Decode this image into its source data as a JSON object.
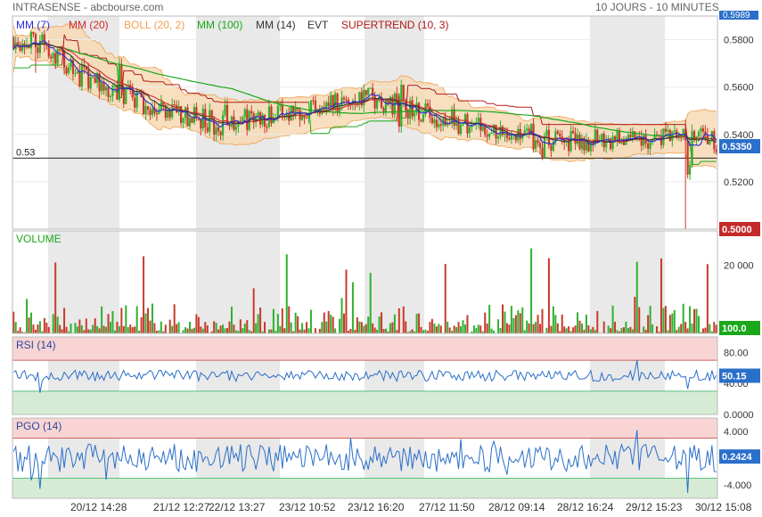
{
  "header": {
    "title": "INTRASENSE - abcbourse.com",
    "period": "10 JOURS - 10 MINUTES"
  },
  "legend": [
    {
      "label": "MM (7)",
      "color": "#2a2ad6"
    },
    {
      "label": "MM (20)",
      "color": "#d12a2a"
    },
    {
      "label": "BOLL (20, 2)",
      "color": "#f0a050"
    },
    {
      "label": "MM (100)",
      "color": "#1aa81a"
    },
    {
      "label": "MM (14)",
      "color": "#333333"
    },
    {
      "label": "EVT",
      "color": "#333333"
    },
    {
      "label": "SUPERTREND (10, 3)",
      "color": "#b01818"
    }
  ],
  "colors": {
    "up": "#2fb12f",
    "down": "#c93a2a",
    "boll_fill": "#f6d9b5",
    "boll_line": "#f0a050",
    "mm7": "#2a2ad6",
    "mm20": "#d12a2a",
    "mm100": "#1aa81a",
    "mm14": "#333333",
    "supertrend": "#b01818",
    "rsi_line": "#2a6fc9",
    "pgo_line": "#2a6fc9",
    "overbought": "#f8d4d4",
    "oversold": "#d6ebd3",
    "badge_current": "#2a6fc9",
    "badge_low": "#c42a2a",
    "badge_volume": "#1aa81a",
    "shade": "#e9e9e9"
  },
  "chart_data": [
    {
      "type": "candlestick",
      "name": "price",
      "yticks": [
        "0.5200",
        "0.5400",
        "0.5600",
        "0.5800"
      ],
      "ylim": [
        0.5,
        0.59
      ],
      "reference_line": {
        "value": 0.53,
        "label": "0.53"
      },
      "last_value": "0.5350",
      "min_label": "0.5000",
      "top_partial_label": "0.5989",
      "key_points": [
        {
          "x": "20/12 09:00",
          "y": 0.581
        },
        {
          "x": "20/12 14:28",
          "y": 0.553
        },
        {
          "x": "21/12 12:27",
          "y": 0.545
        },
        {
          "x": "22/12 13:27",
          "y": 0.553
        },
        {
          "x": "23/12 10:52",
          "y": 0.555
        },
        {
          "x": "23/12 16:20",
          "y": 0.542
        },
        {
          "x": "27/12 11:50",
          "y": 0.537
        },
        {
          "x": "28/12 09:14",
          "y": 0.537
        },
        {
          "x": "28/12 16:24",
          "y": 0.539
        },
        {
          "x": "29/12 15:23",
          "y": 0.54
        },
        {
          "x": "30/12 15:08",
          "y": 0.535
        }
      ]
    },
    {
      "type": "bar",
      "name": "volume",
      "title": "VOLUME",
      "yticks": [
        "20 000"
      ],
      "last_value": "100.0"
    },
    {
      "type": "line",
      "name": "rsi",
      "title": "RSI (14)",
      "yticks": [
        "80.00",
        "40.00",
        "0.0000"
      ],
      "ylim": [
        0,
        100
      ],
      "overbought": 70,
      "oversold": 30,
      "last_value": "50.15"
    },
    {
      "type": "line",
      "name": "pgo",
      "title": "PGO (14)",
      "yticks": [
        "4.000",
        "-4.000"
      ],
      "ylim": [
        -6,
        6
      ],
      "overbought": 3,
      "oversold": -3,
      "last_value": "0.2424"
    }
  ],
  "xaxis": {
    "labels": [
      "20/12 14:28",
      "21/12 12:27",
      "22/12 13:27",
      "23/12 10:52",
      "23/12 16:20",
      "27/12 11:50",
      "28/12 09:14",
      "28/12 16:24",
      "29/12 15:23",
      "30/12 15:08"
    ]
  }
}
